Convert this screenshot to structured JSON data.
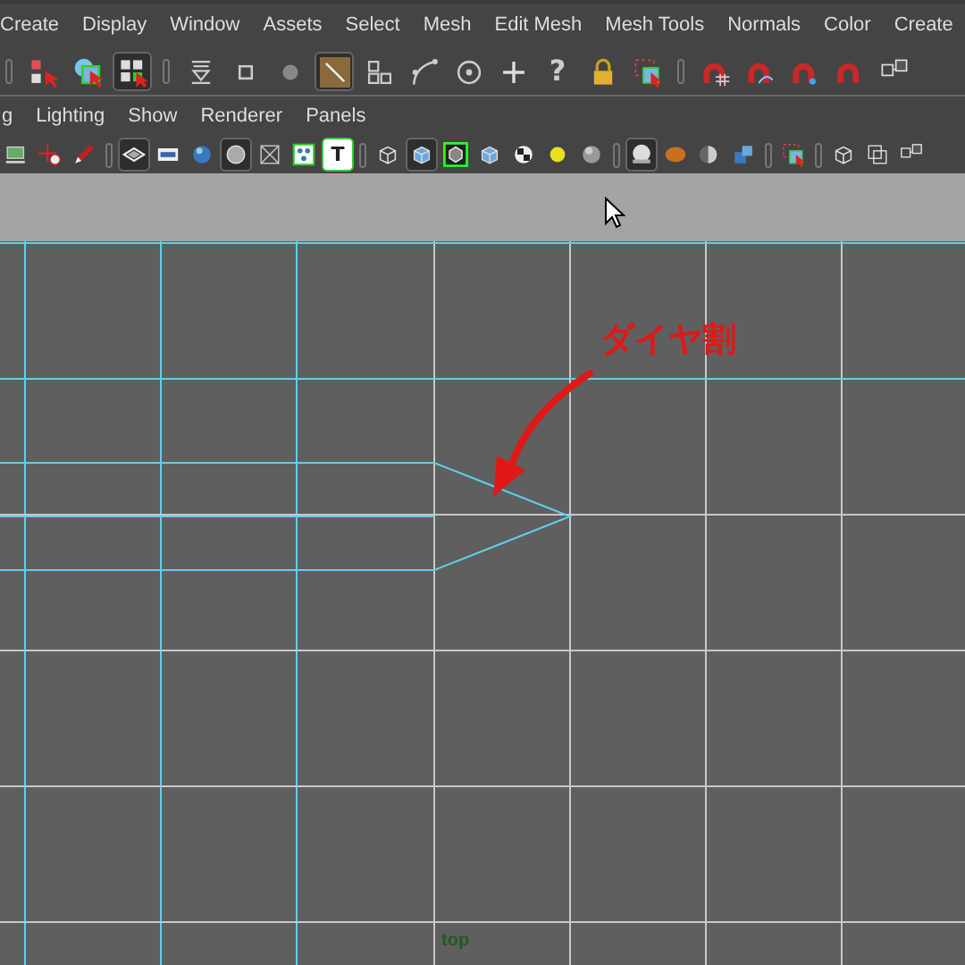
{
  "menu_bar": [
    "Create",
    "Display",
    "Window",
    "Assets",
    "Select",
    "Mesh",
    "Edit Mesh",
    "Mesh Tools",
    "Normals",
    "Color",
    "Create"
  ],
  "toolbar": [
    {
      "kind": "grip"
    },
    {
      "kind": "hierarchy",
      "selected": false
    },
    {
      "kind": "object",
      "selected": false
    },
    {
      "kind": "component",
      "selected": true
    },
    {
      "kind": "grip"
    },
    {
      "kind": "hourglass",
      "selected": false
    },
    {
      "kind": "square",
      "selected": false
    },
    {
      "kind": "dot",
      "selected": false
    },
    {
      "kind": "diagonal",
      "selected": true
    },
    {
      "kind": "blocks",
      "selected": false
    },
    {
      "kind": "curve",
      "selected": false
    },
    {
      "kind": "target",
      "selected": false
    },
    {
      "kind": "plus",
      "selected": false
    },
    {
      "kind": "glyph",
      "glyph": "?",
      "selected": false
    },
    {
      "kind": "lock",
      "selected": false
    },
    {
      "kind": "marquee",
      "selected": false
    },
    {
      "kind": "grip"
    },
    {
      "kind": "magnetgrid",
      "selected": false
    },
    {
      "kind": "magnetcurve",
      "selected": false
    },
    {
      "kind": "magnetpoint",
      "selected": false
    },
    {
      "kind": "magnet",
      "selected": false
    },
    {
      "kind": "nodes",
      "selected": false
    }
  ],
  "panel_menu": [
    "g",
    "Lighting",
    "Show",
    "Renderer",
    "Panels"
  ],
  "panel_toolbar": [
    {
      "kind": "monitor",
      "selected": false
    },
    {
      "kind": "move",
      "selected": false
    },
    {
      "kind": "pencil",
      "selected": false
    },
    {
      "kind": "grip"
    },
    {
      "kind": "camera",
      "selected": true
    },
    {
      "kind": "film",
      "selected": false
    },
    {
      "kind": "sphere",
      "selected": false
    },
    {
      "kind": "circle",
      "selected": true
    },
    {
      "kind": "xray",
      "selected": false
    },
    {
      "kind": "dots",
      "selected": false
    },
    {
      "kind": "glyph",
      "glyph": "T",
      "selected": false
    },
    {
      "kind": "grip"
    },
    {
      "kind": "wirecube",
      "selected": false
    },
    {
      "kind": "cube",
      "selected": true
    },
    {
      "kind": "wireshade",
      "selected": false
    },
    {
      "kind": "cube",
      "selected": false
    },
    {
      "kind": "checker",
      "selected": false
    },
    {
      "kind": "light",
      "selected": false
    },
    {
      "kind": "greysphere",
      "selected": false
    },
    {
      "kind": "grip"
    },
    {
      "kind": "chrome",
      "selected": true
    },
    {
      "kind": "orange",
      "selected": false
    },
    {
      "kind": "halfsphere",
      "selected": false
    },
    {
      "kind": "bluecubes",
      "selected": false
    },
    {
      "kind": "grip"
    },
    {
      "kind": "marquee",
      "selected": false
    },
    {
      "kind": "grip"
    },
    {
      "kind": "wirecube",
      "selected": false
    },
    {
      "kind": "squares",
      "selected": false
    },
    {
      "kind": "nodes",
      "selected": false
    }
  ],
  "viewport": {
    "annotation": "ダイヤ割",
    "camera_label": "top"
  }
}
